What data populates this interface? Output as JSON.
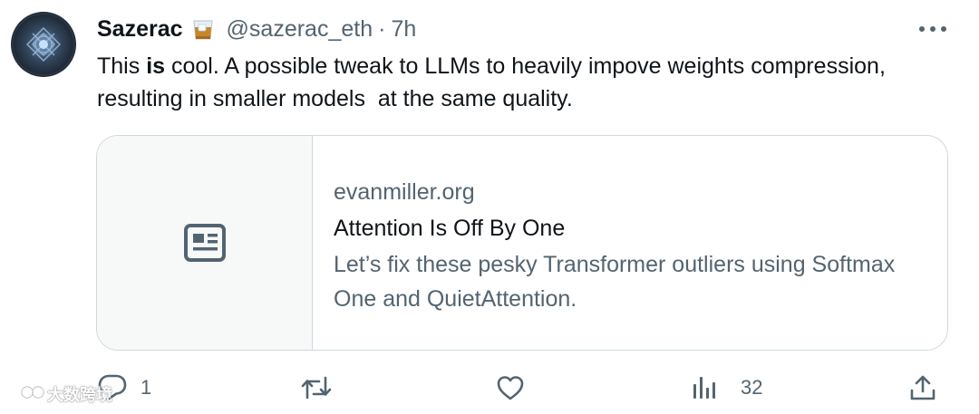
{
  "tweet": {
    "display_name": "Sazerac",
    "emoji_icon": "whiskey-glass-icon",
    "handle": "@sazerac_eth",
    "separator": "·",
    "time": "7h",
    "text_before": "This ",
    "text_bold": "is",
    "text_after": " cool. A possible tweak to LLMs to heavily impove weights compression, resulting in smaller models  at the same quality."
  },
  "card": {
    "thumb_icon": "article-icon",
    "domain": "evanmiller.org",
    "title": "Attention Is Off By One",
    "description": "Let’s fix these pesky Transformer outliers using Softmax One and QuietAttention."
  },
  "actions": {
    "reply": {
      "icon": "reply-icon",
      "count": "1"
    },
    "retweet": {
      "icon": "retweet-icon",
      "count": ""
    },
    "like": {
      "icon": "heart-icon",
      "count": ""
    },
    "views": {
      "icon": "views-icon",
      "count": "32"
    },
    "share": {
      "icon": "share-icon"
    }
  },
  "watermark": {
    "text": "大数跨境"
  },
  "colors": {
    "text_primary": "#0f1419",
    "text_secondary": "#536471",
    "border": "#cfd9de",
    "card_thumb_bg": "#f7f9f9"
  }
}
